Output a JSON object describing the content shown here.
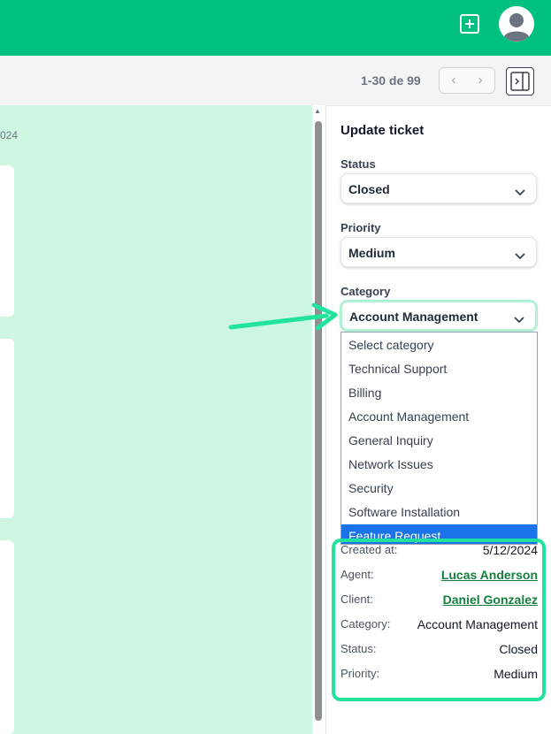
{
  "header": {
    "brand_color": "#00c07f",
    "add_icon": "plus-square-icon",
    "avatar_icon": "user-avatar-icon"
  },
  "toolbar": {
    "page_range": "1-30 de 99",
    "prev_icon": "chevron-left-icon",
    "next_icon": "chevron-right-icon",
    "panel_icon": "sidebar-toggle-icon"
  },
  "list": {
    "date_fragment": "024"
  },
  "panel": {
    "title": "Update ticket",
    "status": {
      "label": "Status",
      "value": "Closed"
    },
    "priority": {
      "label": "Priority",
      "value": "Medium"
    },
    "category": {
      "label": "Category",
      "value": "Account Management",
      "options": [
        "Select category",
        "Technical Support",
        "Billing",
        "Account Management",
        "General Inquiry",
        "Network Issues",
        "Security",
        "Software Installation",
        "Feature Request"
      ],
      "highlighted": "Feature Request"
    },
    "details": [
      {
        "key": "Created at:",
        "value": "5/12/2024",
        "link": false
      },
      {
        "key": "Agent:",
        "value": "Lucas Anderson",
        "link": true
      },
      {
        "key": "Client:",
        "value": "Daniel Gonzalez",
        "link": true
      },
      {
        "key": "Category:",
        "value": "Account Management",
        "link": false
      },
      {
        "key": "Status:",
        "value": "Closed",
        "link": false
      },
      {
        "key": "Priority:",
        "value": "Medium",
        "link": false
      }
    ]
  },
  "annotation": {
    "highlight_color": "#22e39c"
  }
}
